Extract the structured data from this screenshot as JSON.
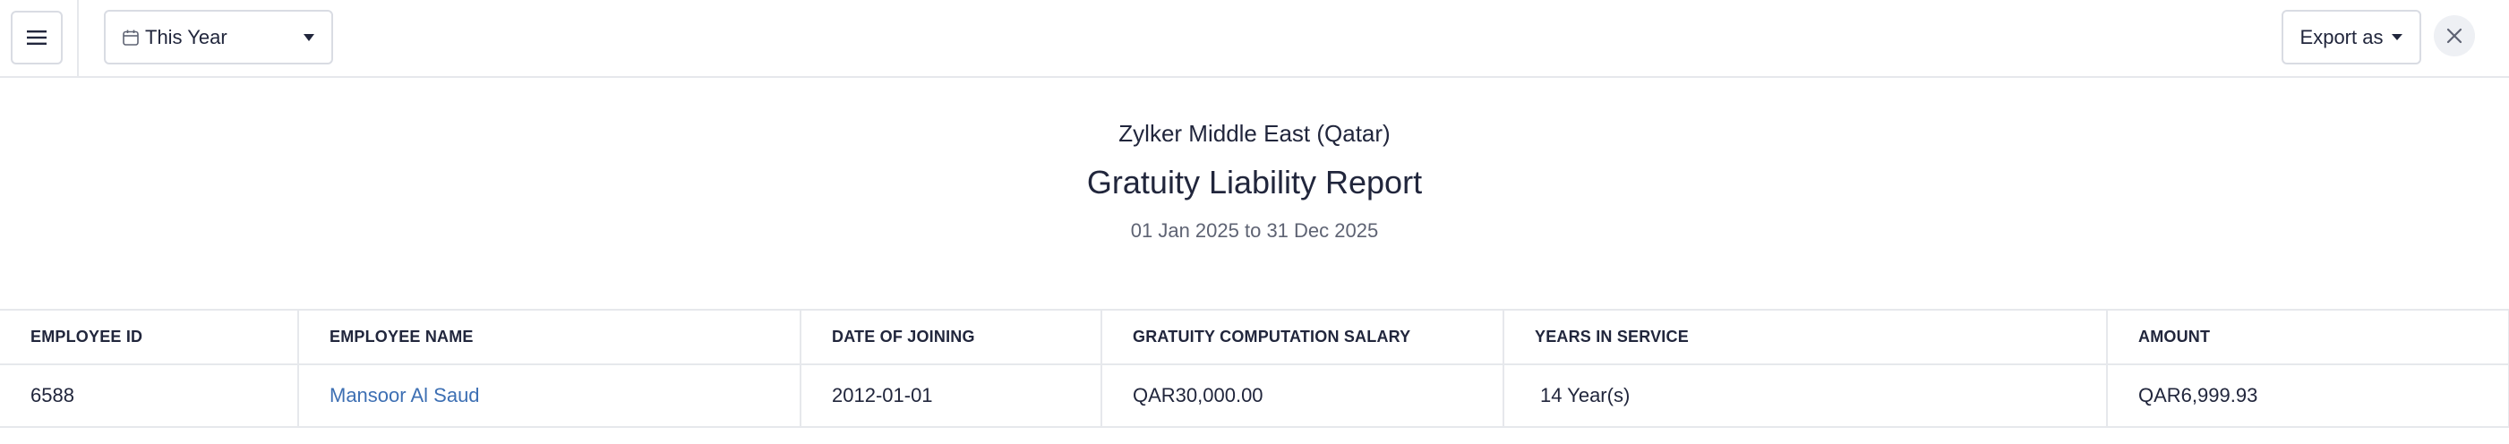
{
  "toolbar": {
    "menu_icon": "hamburger-menu-icon",
    "period": {
      "icon": "calendar-icon",
      "selected": "This Year",
      "caret_icon": "caret-down-icon"
    },
    "export": {
      "label": "Export as",
      "caret_icon": "caret-down-icon"
    },
    "close_icon": "close-icon"
  },
  "report": {
    "organization": "Zylker Middle East (Qatar)",
    "title": "Gratuity Liability Report",
    "date_range": "01 Jan 2025 to 31 Dec 2025"
  },
  "table": {
    "columns": [
      "EMPLOYEE ID",
      "EMPLOYEE NAME",
      "DATE OF JOINING",
      "GRATUITY COMPUTATION SALARY",
      "YEARS IN SERVICE",
      "AMOUNT"
    ],
    "rows": [
      {
        "employee_id": "6588",
        "employee_name": "Mansoor Al Saud",
        "date_of_joining": "2012-01-01",
        "gratuity_salary": "QAR30,000.00",
        "years_in_service": "14 Year(s)",
        "amount": "QAR6,999.93"
      }
    ]
  },
  "colors": {
    "link": "#3d6fb3",
    "border": "#e6e8ec",
    "text": "#21263c",
    "muted": "#5e6373"
  }
}
